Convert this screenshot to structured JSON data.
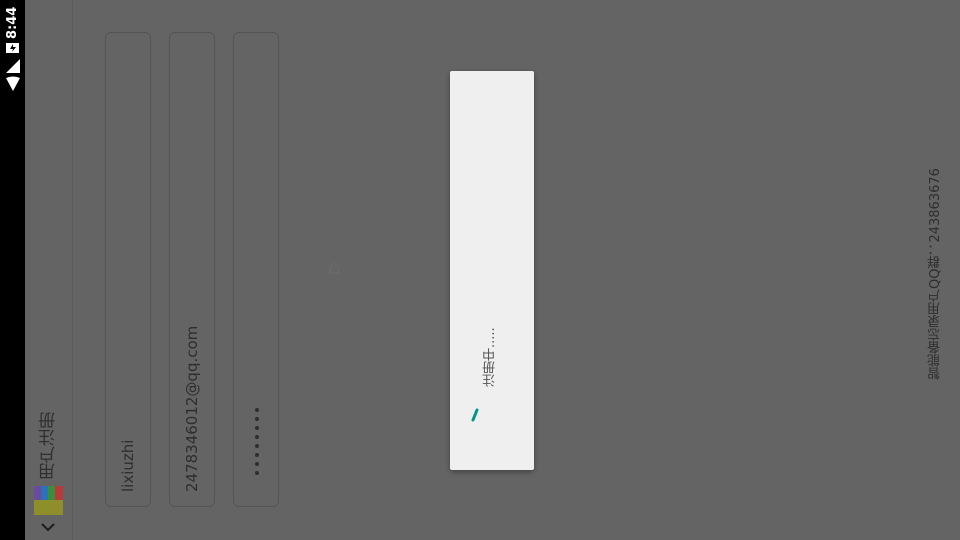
{
  "status_bar": {
    "time": "8:44",
    "icons": [
      "wifi-icon",
      "cell-signal-icon",
      "battery-charging-icon"
    ]
  },
  "action_bar": {
    "title": "用户注册",
    "icon": "app-logo-icon",
    "up_icon": "chevron-down-icon"
  },
  "form": {
    "username_value": "lixiuzhi",
    "email_value": "2478346012@qq.com",
    "password_masked": "••••••••",
    "password_length": 8
  },
  "footer": {
    "text": "智能备忘录用户QQ群：243863676"
  },
  "dialog": {
    "message": "注册中.....",
    "spinner_icon": "loading-spinner-icon",
    "accent_color": "#009688"
  },
  "colors": {
    "scrim": "#646464",
    "dialog_bg": "#efefef",
    "status_bar": "#000000"
  }
}
